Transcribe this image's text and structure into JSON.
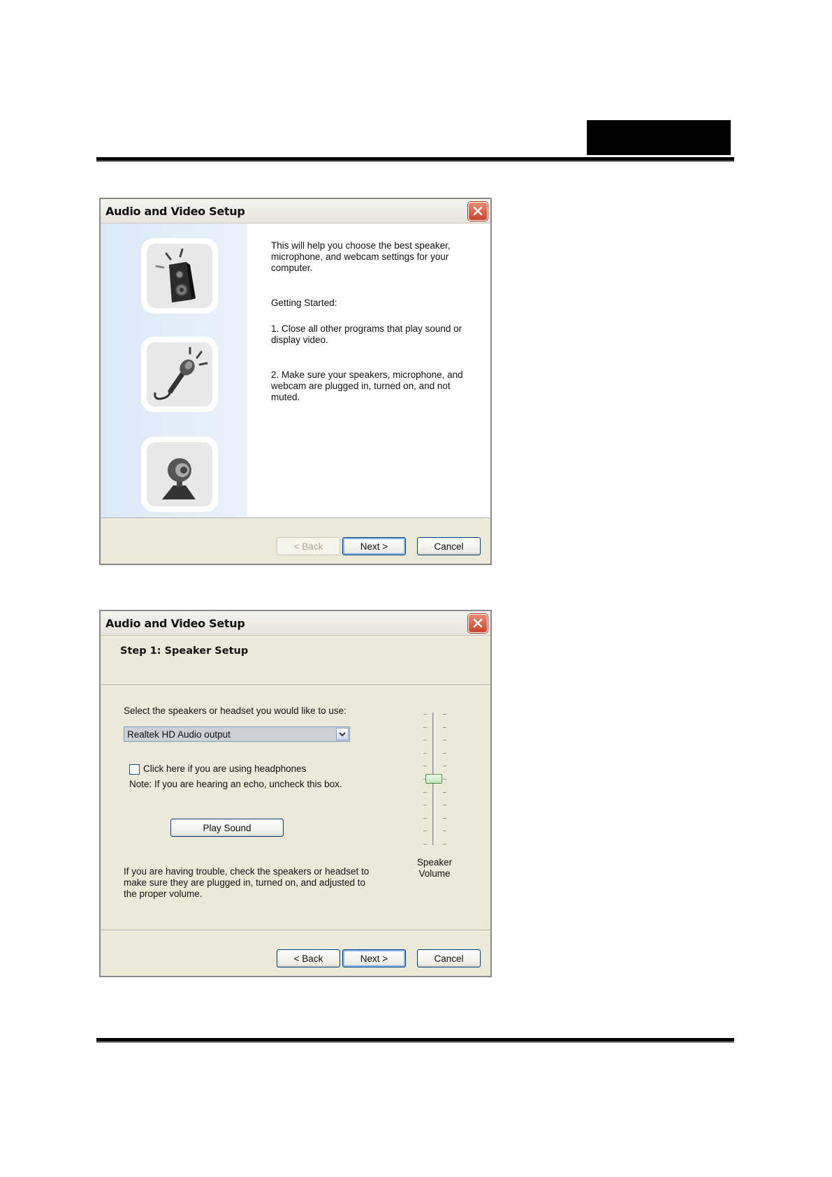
{
  "window1": {
    "title": "Audio and Video Setup",
    "intro": "This will help you choose the best speaker, microphone, and webcam settings for your computer.",
    "getting_started": "Getting Started:",
    "step1": "1. Close all other programs that play sound or display video.",
    "step2": "2. Make sure your speakers, microphone, and webcam are plugged in, turned on, and not muted.",
    "icons": [
      "speaker-icon",
      "microphone-icon",
      "webcam-icon"
    ],
    "buttons": {
      "back": "< Back",
      "next": "Next >",
      "cancel": "Cancel"
    }
  },
  "window2": {
    "title": "Audio and Video Setup",
    "step_heading": "Step 1: Speaker Setup",
    "select_label": "Select the speakers or headset you would like to use:",
    "selected_device": "Realtek HD Audio output",
    "headphones_label": "Click here if you are using headphones",
    "headphones_checked": false,
    "note": "Note: If you are hearing an echo, uncheck this box.",
    "play_sound": "Play Sound",
    "trouble_text": "If you are having trouble, check the speakers or headset to make sure they are plugged in, turned on, and adjusted to the proper volume.",
    "volume_label_line1": "Speaker",
    "volume_label_line2": "Volume",
    "volume_level": 0.5,
    "buttons": {
      "back": "< Back",
      "next": "Next >",
      "cancel": "Cancel"
    }
  },
  "colors": {
    "close_button": "#c8452c",
    "button_border": "#003c74",
    "left_panel": "#dbe9f6"
  }
}
